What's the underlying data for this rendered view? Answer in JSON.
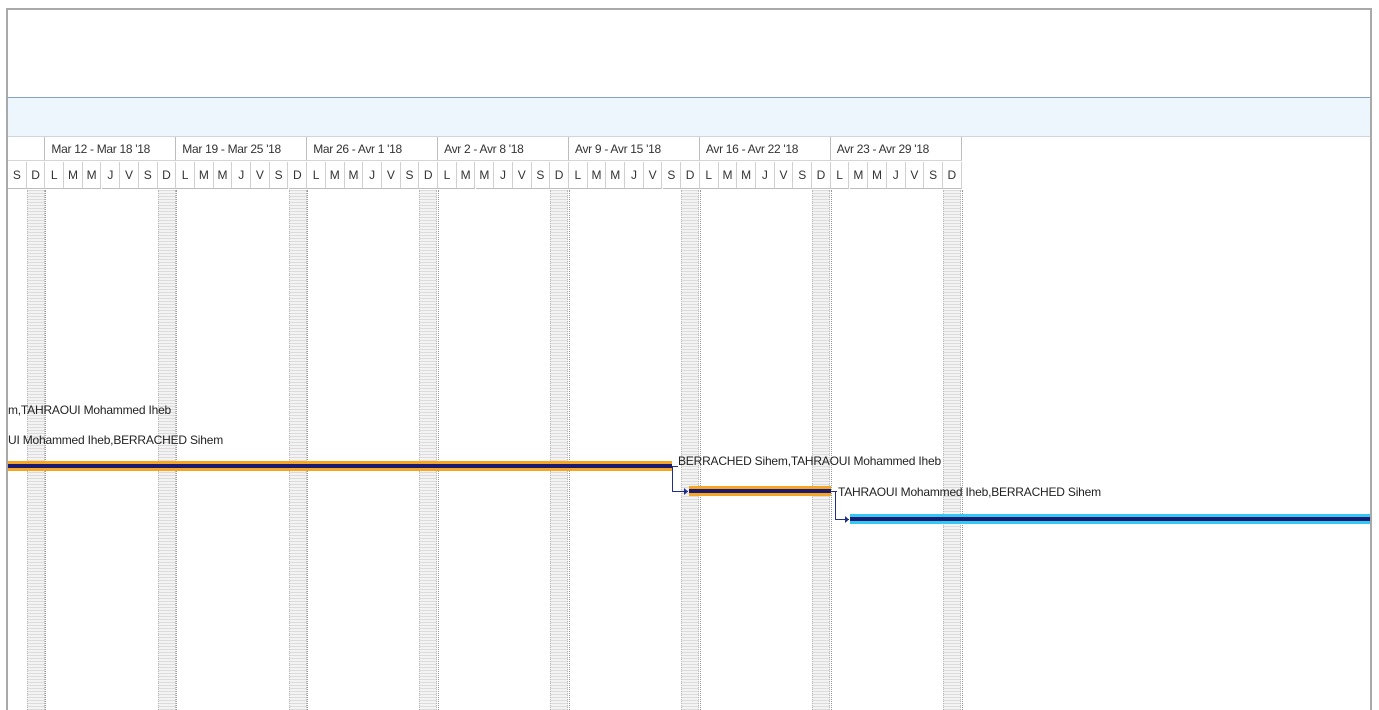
{
  "timescale": {
    "weeks": [
      "Mar 12 - Mar 18 '18",
      "Mar 19 - Mar 25 '18",
      "Mar 26 - Avr 1 '18",
      "Avr 2 - Avr 8 '18",
      "Avr 9 - Avr 15 '18",
      "Avr 16 - Avr 22 '18",
      "Avr 23 - Avr 29 '18"
    ],
    "days": [
      "S",
      "D",
      "L",
      "M",
      "M",
      "J",
      "V",
      "S",
      "D",
      "L",
      "M",
      "M",
      "J",
      "V",
      "S",
      "D",
      "L",
      "M",
      "M",
      "J",
      "V",
      "S",
      "D",
      "L",
      "M",
      "M",
      "J",
      "V",
      "S",
      "D",
      "L",
      "M",
      "M",
      "J",
      "V",
      "S",
      "D",
      "L",
      "M",
      "M",
      "J",
      "V",
      "S",
      "D",
      "L",
      "M",
      "M",
      "J",
      "V",
      "S",
      "D"
    ]
  },
  "tasks": {
    "label_1": "m,TAHRAOUI Mohammed Iheb",
    "label_2": "UI Mohammed Iheb,BERRACHED Sihem",
    "label_3": "BERRACHED Sihem,TAHRAOUI Mohammed Iheb",
    "label_4": "TAHRAOUI Mohammed Iheb,BERRACHED Sihem"
  },
  "colors": {
    "task_bar": "#f6a623",
    "progress": "#1a1a6e",
    "critical_bar": "#33c9f5",
    "link": "#1f2f8a",
    "header_band": "#eef6fd"
  }
}
